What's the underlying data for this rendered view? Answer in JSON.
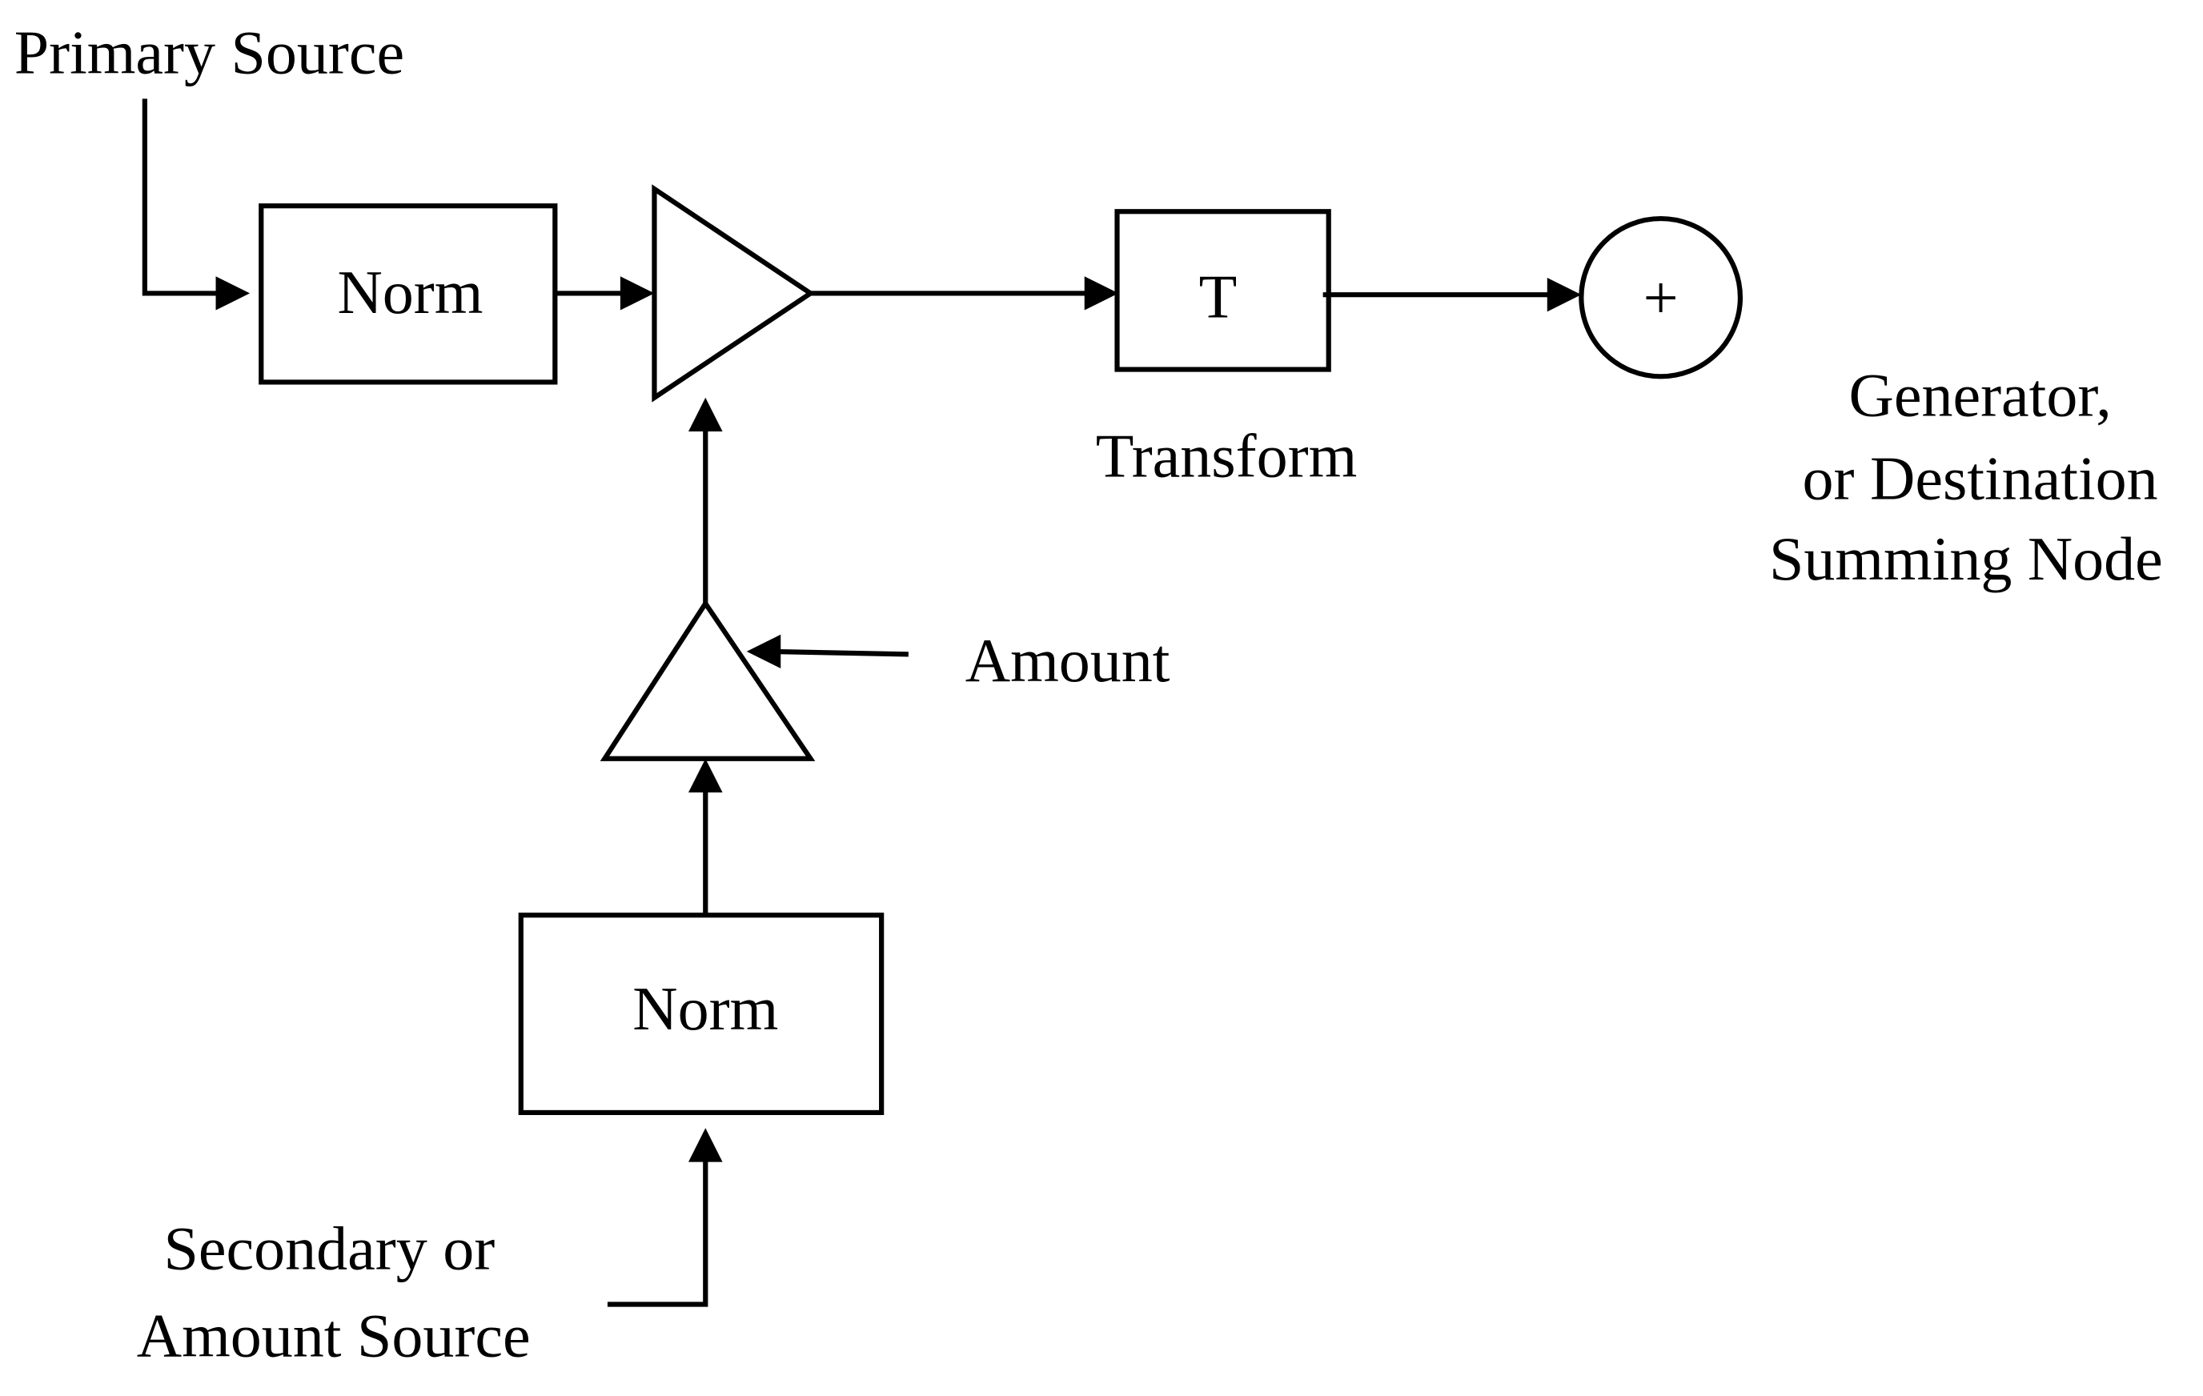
{
  "labels": {
    "primary_source": "Primary Source",
    "norm_primary": "Norm",
    "transform_box": "T",
    "transform_label": "Transform",
    "summing_node": "+",
    "destination_line1": "Generator,",
    "destination_line2": "or Destination",
    "destination_line3": "Summing Node",
    "amount": "Amount",
    "norm_secondary": "Norm",
    "secondary_line1": "Secondary or",
    "secondary_line2": "Amount Source"
  }
}
